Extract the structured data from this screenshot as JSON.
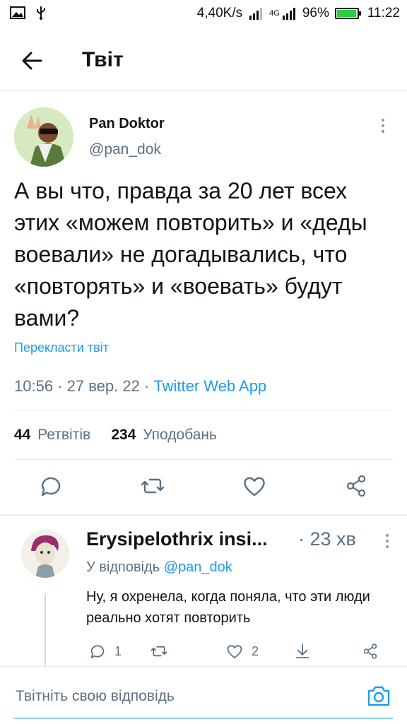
{
  "status_bar": {
    "speed": "4,40K/s",
    "network": "4G",
    "battery": "96%",
    "battery_level": 0.96,
    "time": "11:22"
  },
  "header": {
    "title": "Твіт"
  },
  "tweet": {
    "author_name": "Pan Doktor",
    "author_handle": "@pan_dok",
    "text": "А вы что, правда за 20 лет всех этих «можем повторить» и «деды воевали» не догадывались, что «повторять» и «воевать» будут вами?",
    "translate_label": "Перекласти твіт",
    "time": "10:56",
    "date": "27 вер. 22",
    "source": "Twitter Web App",
    "retweets_count": "44",
    "retweets_label": "Ретвітів",
    "likes_count": "234",
    "likes_label": "Уподобань"
  },
  "reply": {
    "author_name": "Erysipelothrix insi...",
    "time": "· 23 хв",
    "replying_prefix": "У відповідь",
    "replying_to": "@pan_dok",
    "text": "Ну, я охренела, когда поняла, что эти люди реально хотят повторить",
    "reply_count": "1",
    "like_count": "2"
  },
  "compose": {
    "placeholder": "Твітніть свою відповідь"
  },
  "colors": {
    "accent": "#1d9bf0",
    "secondary_text": "#5b7083",
    "divider": "#e6ecf0"
  }
}
